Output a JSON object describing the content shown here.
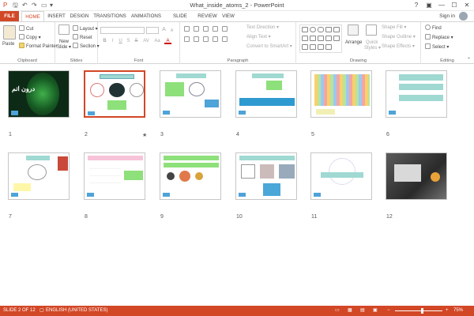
{
  "titlebar": {
    "title": "What_inside_atoms_2 - PowerPoint",
    "help": "?",
    "restore": "▣",
    "minimize": "—",
    "maximize": "☐",
    "close": "✕"
  },
  "qat": {
    "save": "🖫",
    "undo": "↶",
    "redo": "↷",
    "present": "▭",
    "customize": "▾"
  },
  "tabs": [
    "FILE",
    "HOME",
    "INSERT",
    "DESIGN",
    "TRANSITIONS",
    "ANIMATIONS",
    "SLIDE SHOW",
    "REVIEW",
    "VIEW"
  ],
  "account": {
    "signin": "Sign in"
  },
  "ribbon": {
    "clipboard": {
      "paste": "Paste",
      "cut": "Cut",
      "copy": "Copy ▾",
      "format_painter": "Format Painter",
      "label": "Clipboard"
    },
    "slides": {
      "new_slide": "New",
      "new_slide2": "Slide ▾",
      "layout": "Layout ▾",
      "reset": "Reset",
      "section": "Section ▾",
      "label": "Slides"
    },
    "font": {
      "label": "Font",
      "grow": "A",
      "shrink": "A",
      "bold": "B",
      "italic": "I",
      "underline": "U",
      "strike": "S",
      "shadow": "S",
      "spacing": "AV",
      "case": "Aa",
      "color": "A"
    },
    "paragraph": {
      "text_direction": "Text Direction ▾",
      "align_text": "Align Text ▾",
      "convert": "Convert to SmartArt ▾",
      "label": "Paragraph"
    },
    "drawing": {
      "arrange": "Arrange",
      "quick_styles": "Quick",
      "quick_styles2": "Styles ▾",
      "shape_fill": "Shape Fill ▾",
      "shape_outline": "Shape Outline ▾",
      "shape_effects": "Shape Effects ▾",
      "label": "Drawing"
    },
    "editing": {
      "find": "Find",
      "replace": "Replace ▾",
      "select": "Select ▾",
      "label": "Editing"
    }
  },
  "slides": [
    {
      "num": "1",
      "title_text": "درون اتم"
    },
    {
      "num": "2",
      "star": "★"
    },
    {
      "num": "3"
    },
    {
      "num": "4"
    },
    {
      "num": "5"
    },
    {
      "num": "6"
    },
    {
      "num": "7"
    },
    {
      "num": "8"
    },
    {
      "num": "9"
    },
    {
      "num": "10"
    },
    {
      "num": "11"
    },
    {
      "num": "12"
    }
  ],
  "status": {
    "slide": "SLIDE 2 OF 12",
    "language": "ENGLISH (UNITED STATES)",
    "zoom": "75%",
    "minus": "−",
    "plus": "+"
  },
  "colors": {
    "accent": "#d24726",
    "thumb_teal": "#9fd9d2",
    "thumb_green": "#8ee07a",
    "thumb_blue": "#4ea3d8",
    "thumb_yellow": "#fff7a8"
  }
}
